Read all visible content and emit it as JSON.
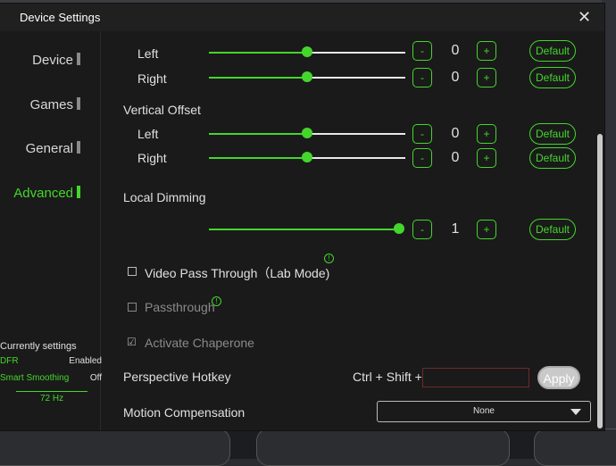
{
  "window": {
    "title": "Device Settings",
    "close_glyph": "✕"
  },
  "sidebar": {
    "items": [
      {
        "label": "Device"
      },
      {
        "label": "Games"
      },
      {
        "label": "General"
      },
      {
        "label": "Advanced",
        "active": true
      }
    ]
  },
  "current_settings": {
    "title": "Currently settings",
    "rows": [
      {
        "key": "DFR",
        "value": "Enabled"
      },
      {
        "key": "Smart Smoothing",
        "value": "Off"
      }
    ],
    "refresh_rate": "72 Hz"
  },
  "horizontal_offset": {
    "left": {
      "label": "Left",
      "value": "0",
      "default_label": "Default"
    },
    "right": {
      "label": "Right",
      "value": "0",
      "default_label": "Default",
      "level": 0.5
    }
  },
  "vertical_offset": {
    "title": "Vertical Offset",
    "left": {
      "label": "Left",
      "value": "0",
      "default_label": "Default",
      "level": 0.5
    },
    "right": {
      "label": "Right",
      "value": "0",
      "default_label": "Default",
      "level": 0.5
    }
  },
  "local_dimming": {
    "title": "Local Dimming",
    "value": "1",
    "default_label": "Default",
    "level": 1.0
  },
  "stepper": {
    "minus": "-",
    "plus": "+"
  },
  "options": {
    "video_pass_through": {
      "label": "Video Pass Through（Lab Mode)",
      "checked": false
    },
    "passthrough": {
      "label": "Passthrough",
      "checked": false
    },
    "activate_chaperone": {
      "label": "Activate Chaperone",
      "checked": true
    }
  },
  "info_glyph": "!",
  "perspective_hotkey": {
    "label": "Perspective Hotkey",
    "prefix": "Ctrl + Shift +",
    "value": "",
    "apply_label": "Apply"
  },
  "motion_compensation": {
    "label": "Motion Compensation",
    "selected": "None"
  },
  "colors": {
    "accent": "#44d62c",
    "window_bg": "#1a1a1a",
    "title_bg": "#202020"
  }
}
